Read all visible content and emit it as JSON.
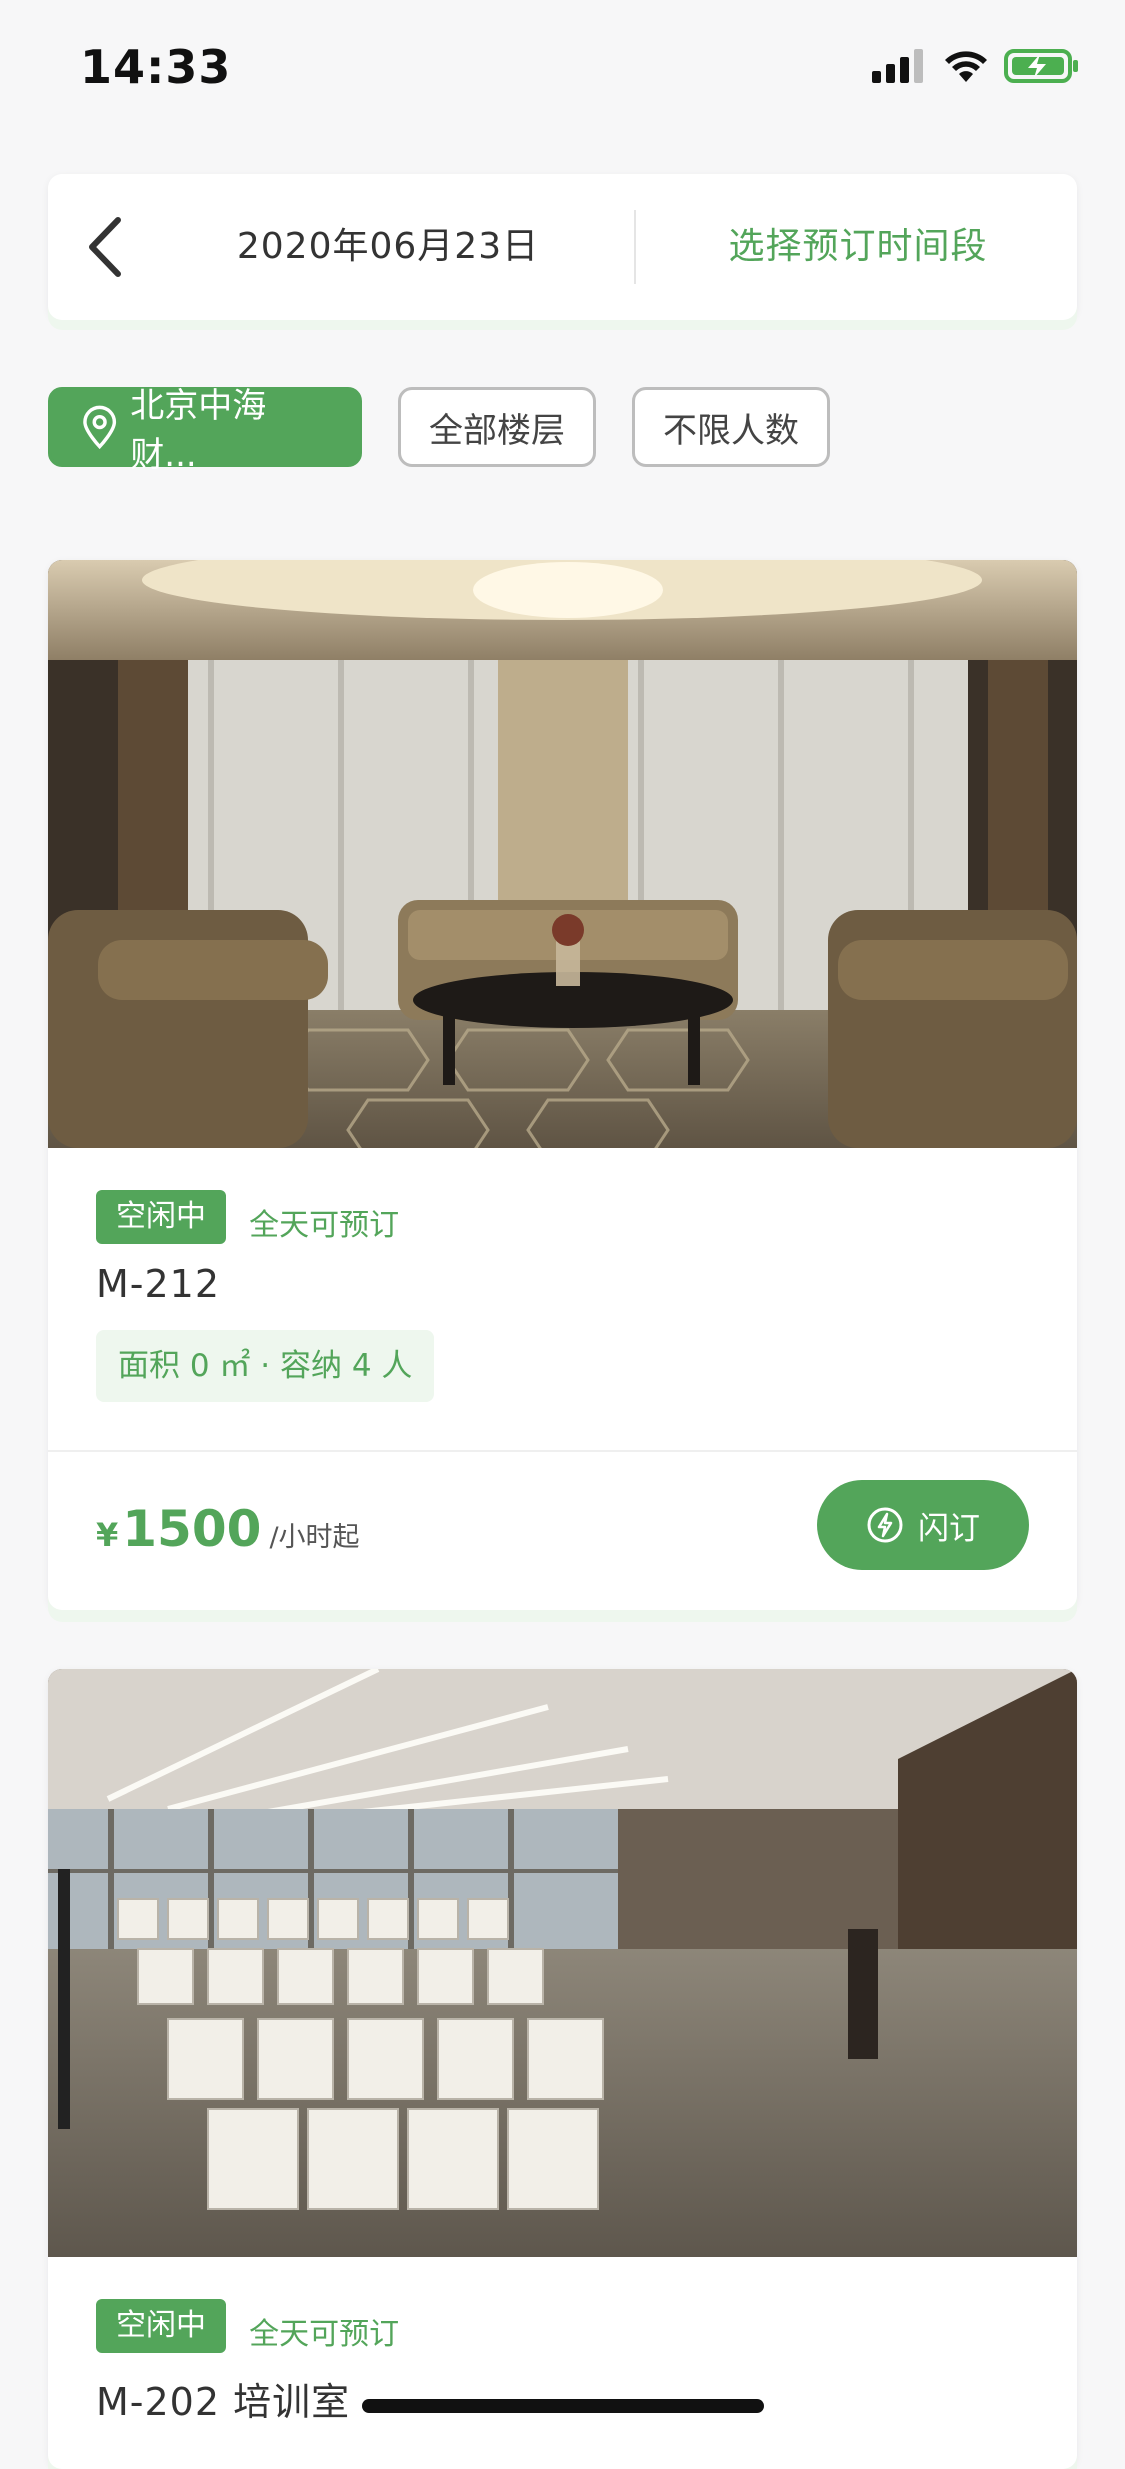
{
  "status": {
    "time": "14:33"
  },
  "header": {
    "date": "2020年06月23日",
    "action_label": "选择预订时间段"
  },
  "filters": [
    {
      "label": "北京中海财...",
      "active": true
    },
    {
      "label": "全部楼层",
      "active": false
    },
    {
      "label": "不限人数",
      "active": false
    }
  ],
  "rooms": [
    {
      "status": "空闲中",
      "availability": "全天可预订",
      "name": "M-212",
      "spec": "面积 0 ㎡ · 容纳 4 人",
      "currency": "¥",
      "price": "1500",
      "price_unit": "/小时起",
      "book_label": "闪订"
    },
    {
      "status": "空闲中",
      "availability": "全天可预订",
      "name": "M-202 培训室"
    }
  ],
  "colors": {
    "accent": "#53a55a",
    "accent_light": "#eef7ee"
  }
}
